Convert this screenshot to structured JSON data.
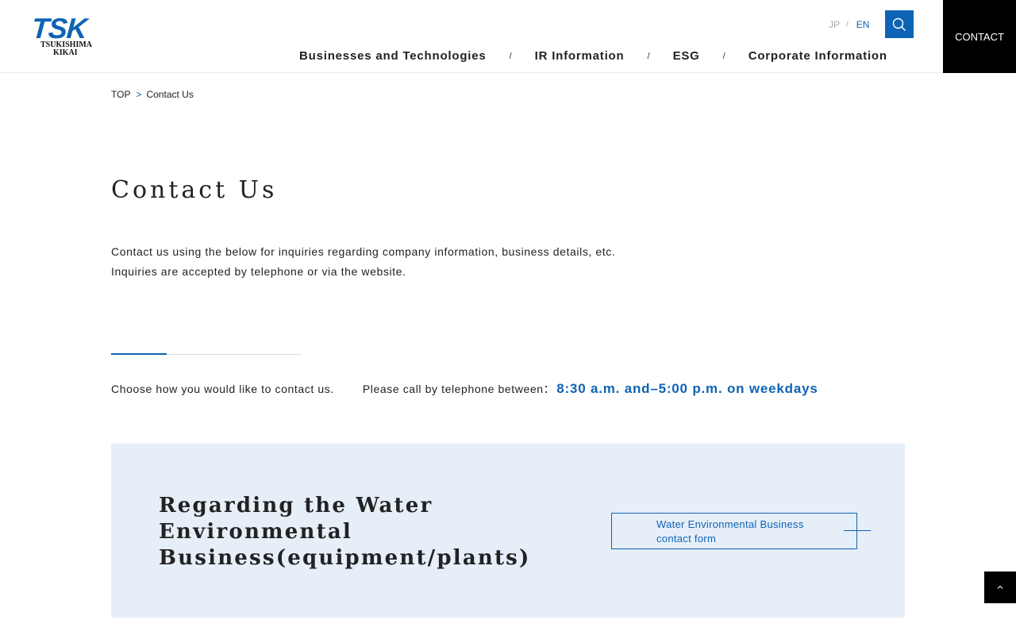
{
  "header": {
    "logo_main": "TSK",
    "logo_line1": "TSUKISHIMA",
    "logo_line2": "KIKAI",
    "lang_jp": "JP",
    "lang_sep": "/",
    "lang_en": "EN",
    "nav": [
      {
        "label": "Businesses and Technologies"
      },
      {
        "label": "IR Information"
      },
      {
        "label": "ESG"
      },
      {
        "label": "Corporate Information"
      }
    ],
    "nav_sep": "/",
    "contact_label": "CONTACT"
  },
  "breadcrumb": {
    "home": "TOP",
    "sep": ">",
    "current": "Contact Us"
  },
  "page": {
    "title": "Contact Us",
    "intro_line1": "Contact us using the below for inquiries regarding company information, business details, etc.",
    "intro_line2": "Inquiries are accepted by telephone or via the website.",
    "choose_text": "Choose how you would like to contact us.",
    "call_text": "Please call by telephone between：",
    "hours_text": "8:30 a.m. and–5:00 p.m. on weekdays"
  },
  "card": {
    "title": "Regarding the Water Environmental Business(equipment/plants)",
    "button_label": "Water Environmental Business contact form"
  },
  "colors": {
    "accent": "#0e63b5",
    "card_bg": "#e6eef8",
    "contact_bg": "#000000"
  },
  "icons": {
    "search": "search-icon",
    "to_top": "chevron-up-icon"
  }
}
